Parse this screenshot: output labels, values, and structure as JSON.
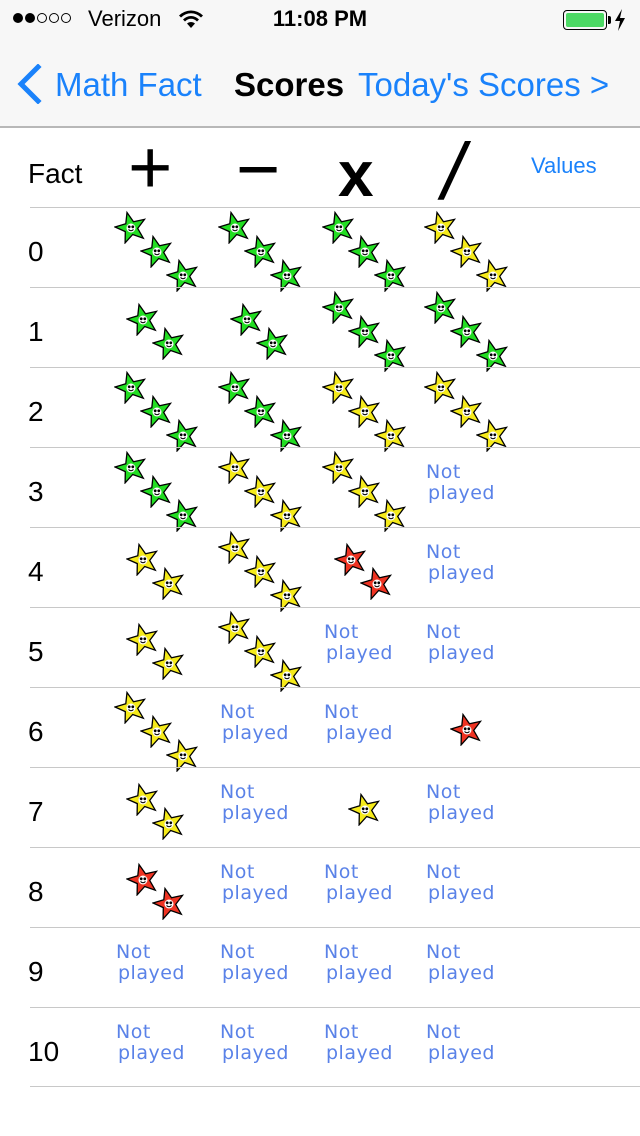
{
  "status_bar": {
    "signal_bars_filled": 2,
    "signal_bars_total": 5,
    "carrier": "Verizon",
    "time": "11:08 PM",
    "battery_color": "#4cd964",
    "charging": true
  },
  "nav": {
    "back_label": "Math Fact",
    "title": "Scores",
    "right_label": "Today's Scores >"
  },
  "table": {
    "fact_header": "Fact",
    "operations": [
      "+",
      "−",
      "x",
      "/"
    ],
    "values_link": "Values",
    "not_played_line1": "Not",
    "not_played_line2": "played",
    "star_colors": {
      "green": "#22dd22",
      "yellow": "#f5ea1a",
      "red": "#ee3322"
    },
    "rows": [
      {
        "fact": "0",
        "scores": [
          {
            "stars": 3,
            "color": "green"
          },
          {
            "stars": 3,
            "color": "green"
          },
          {
            "stars": 3,
            "color": "green"
          },
          {
            "stars": 3,
            "color": "yellow"
          }
        ]
      },
      {
        "fact": "1",
        "scores": [
          {
            "stars": 2,
            "color": "green"
          },
          {
            "stars": 2,
            "color": "green"
          },
          {
            "stars": 3,
            "color": "green"
          },
          {
            "stars": 3,
            "color": "green"
          }
        ]
      },
      {
        "fact": "2",
        "scores": [
          {
            "stars": 3,
            "color": "green"
          },
          {
            "stars": 3,
            "color": "green"
          },
          {
            "stars": 3,
            "color": "yellow"
          },
          {
            "stars": 3,
            "color": "yellow"
          }
        ]
      },
      {
        "fact": "3",
        "scores": [
          {
            "stars": 3,
            "color": "green"
          },
          {
            "stars": 3,
            "color": "yellow"
          },
          {
            "stars": 3,
            "color": "yellow"
          },
          null
        ]
      },
      {
        "fact": "4",
        "scores": [
          {
            "stars": 2,
            "color": "yellow"
          },
          {
            "stars": 3,
            "color": "yellow"
          },
          {
            "stars": 2,
            "color": "red"
          },
          null
        ]
      },
      {
        "fact": "5",
        "scores": [
          {
            "stars": 2,
            "color": "yellow"
          },
          {
            "stars": 3,
            "color": "yellow"
          },
          null,
          null
        ]
      },
      {
        "fact": "6",
        "scores": [
          {
            "stars": 3,
            "color": "yellow"
          },
          null,
          null,
          {
            "stars": 1,
            "color": "red"
          }
        ]
      },
      {
        "fact": "7",
        "scores": [
          {
            "stars": 2,
            "color": "yellow"
          },
          null,
          {
            "stars": 1,
            "color": "yellow"
          },
          null
        ]
      },
      {
        "fact": "8",
        "scores": [
          {
            "stars": 2,
            "color": "red"
          },
          null,
          null,
          null
        ]
      },
      {
        "fact": "9",
        "scores": [
          null,
          null,
          null,
          null
        ]
      },
      {
        "fact": "10",
        "scores": [
          null,
          null,
          null,
          null
        ]
      }
    ]
  }
}
